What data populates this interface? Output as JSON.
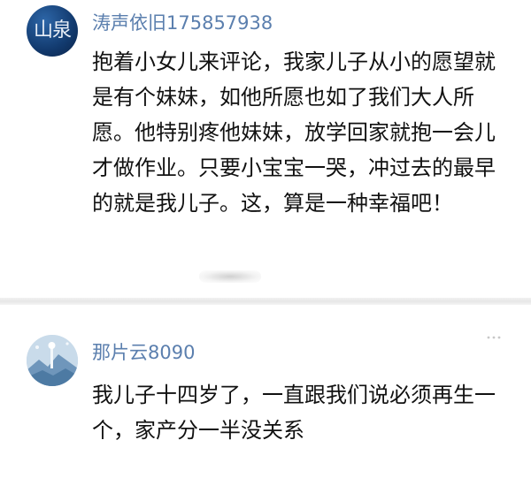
{
  "comments": [
    {
      "username": "涛声依旧175857938",
      "avatar_icon": "ink-calligraphy-avatar",
      "avatar_glyph": "山泉",
      "text": "抱着小女儿来评论，我家儿子从小的愿望就是有个妹妹，如他所愿也如了我们大人所愿。他特别疼他妹妹，放学回家就抱一会儿才做作业。只要小宝宝一哭，冲过去的最早的就是我儿子。这，算是一种幸福吧！"
    },
    {
      "username": "那片云8090",
      "avatar_icon": "blue-landscape-avatar",
      "text": "我儿子十四岁了，一直跟我们说必须再生一个，家产分一半没关系"
    }
  ],
  "colors": {
    "username": "#5b7fae",
    "text": "#111111",
    "background": "#ffffff",
    "avatar_1": "#1a4a85"
  }
}
